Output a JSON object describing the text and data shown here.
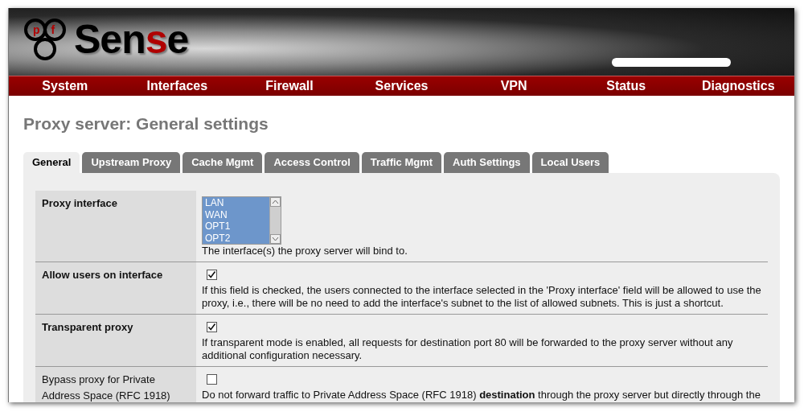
{
  "logo": {
    "ring_letters": [
      "p",
      "f"
    ],
    "parts": [
      {
        "text": "Sen",
        "accent": false
      },
      {
        "text": "s",
        "accent": true
      },
      {
        "text": "e",
        "accent": false
      }
    ]
  },
  "nav": [
    "System",
    "Interfaces",
    "Firewall",
    "Services",
    "VPN",
    "Status",
    "Diagnostics"
  ],
  "page_title": "Proxy server: General settings",
  "tabs": [
    {
      "label": "General",
      "selected": true
    },
    {
      "label": "Upstream Proxy",
      "selected": false
    },
    {
      "label": "Cache Mgmt",
      "selected": false
    },
    {
      "label": "Access Control",
      "selected": false
    },
    {
      "label": "Traffic Mgmt",
      "selected": false
    },
    {
      "label": "Auth Settings",
      "selected": false
    },
    {
      "label": "Local Users",
      "selected": false
    }
  ],
  "rows": [
    {
      "label": "Proxy interface",
      "required": true,
      "kind": "listbox",
      "options": [
        {
          "label": "LAN",
          "selected": true
        },
        {
          "label": "WAN",
          "selected": true
        },
        {
          "label": "OPT1",
          "selected": true
        },
        {
          "label": "OPT2",
          "selected": true
        }
      ],
      "description": "The interface(s) the proxy server will bind to."
    },
    {
      "label": "Allow users on interface",
      "required": true,
      "kind": "checkbox",
      "checked": true,
      "description": "If this field is checked, the users connected to the interface selected in the 'Proxy interface' field will be allowed to use the proxy, i.e., there will be no need to add the interface's subnet to the list of allowed subnets. This is just a shortcut."
    },
    {
      "label": "Transparent proxy",
      "required": true,
      "kind": "checkbox",
      "checked": true,
      "description": "If transparent mode is enabled, all requests for destination port 80 will be forwarded to the proxy server without any additional configuration necessary."
    },
    {
      "label": "Bypass proxy for Private Address Space (RFC 1918)",
      "required": false,
      "kind": "checkbox",
      "checked": false,
      "description": "Do not forward traffic to Private Address Space (RFC 1918) **destination** through the proxy server but directly through the"
    }
  ]
}
